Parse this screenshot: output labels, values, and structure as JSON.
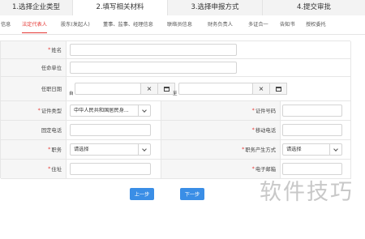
{
  "steps": [
    {
      "label": "1.选择企业类型"
    },
    {
      "label": "2.填写相关材料"
    },
    {
      "label": "3.选择申报方式"
    },
    {
      "label": "4.提交审批"
    }
  ],
  "subtabs": [
    {
      "label": "信息"
    },
    {
      "label": "法定代表人"
    },
    {
      "label": "股东(发起人)"
    },
    {
      "label": "董事、监事、经理信息"
    },
    {
      "label": "联络员信息"
    },
    {
      "label": "财务负责人"
    },
    {
      "label": "多证合一"
    },
    {
      "label": "告知书"
    },
    {
      "label": "授权委托"
    }
  ],
  "form": {
    "name_label": "姓名",
    "position_unit_label": "任命单位",
    "term_label": "任职日期",
    "from_label": "自",
    "to_label": "至",
    "clear_glyph": "×",
    "id_type_label": "证件类型",
    "id_type_value": "中华人民共和国居民身...",
    "id_number_label": "证件号码",
    "landline_label": "固定电话",
    "mobile_label": "移动电话",
    "duty_label": "职务",
    "duty_value": "请选择",
    "duty_source_label": "职务产生方式",
    "duty_source_value": "请选择",
    "address_label": "住址",
    "email_label": "电子邮箱",
    "required_mark": "*"
  },
  "buttons": {
    "prev": "上一步",
    "next": "下一步"
  },
  "watermark": "软件技巧"
}
